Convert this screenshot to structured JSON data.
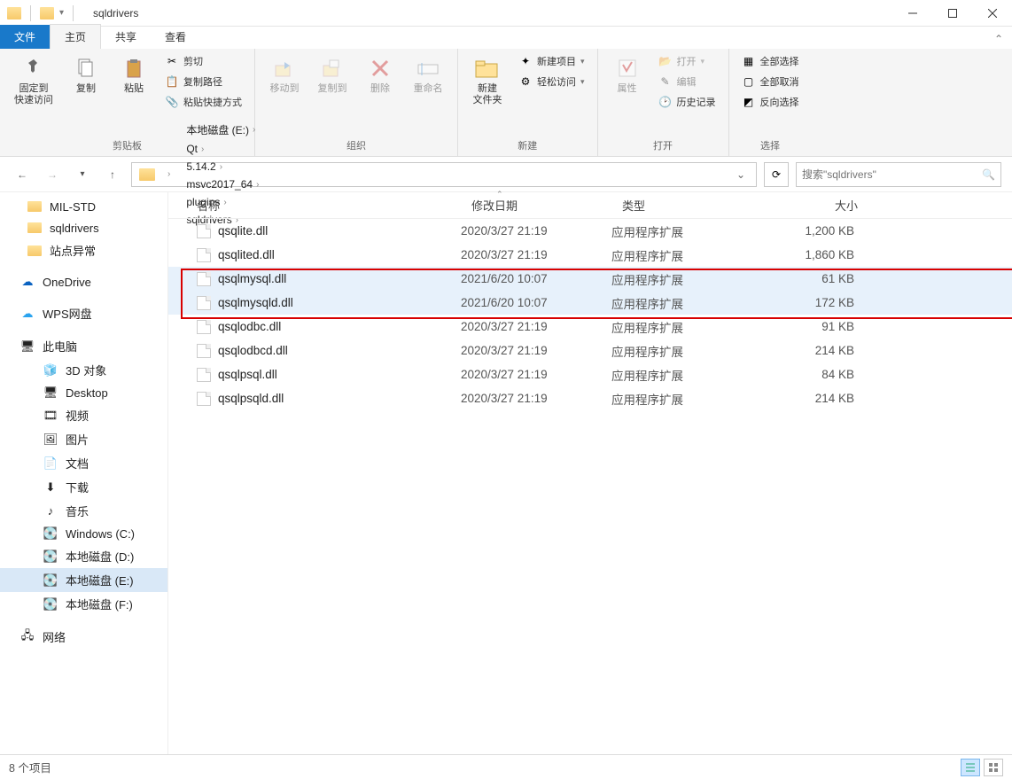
{
  "window": {
    "title": "sqldrivers"
  },
  "tabs": {
    "file": "文件",
    "home": "主页",
    "share": "共享",
    "view": "查看"
  },
  "ribbon": {
    "clipboard": {
      "label": "剪贴板",
      "pin": "固定到\n快速访问",
      "copy": "复制",
      "paste": "粘贴",
      "cut": "剪切",
      "copypath": "复制路径",
      "paste_shortcut": "粘贴快捷方式"
    },
    "organize": {
      "label": "组织",
      "moveto": "移动到",
      "copyto": "复制到",
      "delete": "删除",
      "rename": "重命名"
    },
    "new": {
      "label": "新建",
      "newfolder": "新建\n文件夹",
      "newitem": "新建项目",
      "easyaccess": "轻松访问"
    },
    "open": {
      "label": "打开",
      "properties": "属性",
      "open": "打开",
      "edit": "编辑",
      "history": "历史记录"
    },
    "select": {
      "label": "选择",
      "all": "全部选择",
      "none": "全部取消",
      "invert": "反向选择"
    }
  },
  "breadcrumb": [
    "本地磁盘 (E:)",
    "Qt",
    "5.14.2",
    "msvc2017_64",
    "plugins",
    "sqldrivers"
  ],
  "search": {
    "placeholder": "搜索\"sqldrivers\""
  },
  "columns": {
    "name": "名称",
    "date": "修改日期",
    "type": "类型",
    "size": "大小"
  },
  "sidebar": {
    "folders": [
      "MIL-STD",
      "sqldrivers",
      "站点异常"
    ],
    "onedrive": "OneDrive",
    "wps": "WPS网盘",
    "thispc": "此电脑",
    "pc_items": [
      {
        "label": "3D 对象",
        "icon": "cube"
      },
      {
        "label": "Desktop",
        "icon": "desktop"
      },
      {
        "label": "视频",
        "icon": "video"
      },
      {
        "label": "图片",
        "icon": "pictures"
      },
      {
        "label": "文档",
        "icon": "docs"
      },
      {
        "label": "下载",
        "icon": "downloads"
      },
      {
        "label": "音乐",
        "icon": "music"
      },
      {
        "label": "Windows (C:)",
        "icon": "drive-win"
      },
      {
        "label": "本地磁盘 (D:)",
        "icon": "drive"
      },
      {
        "label": "本地磁盘 (E:)",
        "icon": "drive"
      },
      {
        "label": "本地磁盘 (F:)",
        "icon": "drive"
      }
    ],
    "network": "网络"
  },
  "files": [
    {
      "name": "qsqlite.dll",
      "date": "2020/3/27 21:19",
      "type": "应用程序扩展",
      "size": "1,200 KB"
    },
    {
      "name": "qsqlited.dll",
      "date": "2020/3/27 21:19",
      "type": "应用程序扩展",
      "size": "1,860 KB"
    },
    {
      "name": "qsqlmysql.dll",
      "date": "2021/6/20 10:07",
      "type": "应用程序扩展",
      "size": "61 KB"
    },
    {
      "name": "qsqlmysqld.dll",
      "date": "2021/6/20 10:07",
      "type": "应用程序扩展",
      "size": "172 KB"
    },
    {
      "name": "qsqlodbc.dll",
      "date": "2020/3/27 21:19",
      "type": "应用程序扩展",
      "size": "91 KB"
    },
    {
      "name": "qsqlodbcd.dll",
      "date": "2020/3/27 21:19",
      "type": "应用程序扩展",
      "size": "214 KB"
    },
    {
      "name": "qsqlpsql.dll",
      "date": "2020/3/27 21:19",
      "type": "应用程序扩展",
      "size": "84 KB"
    },
    {
      "name": "qsqlpsqld.dll",
      "date": "2020/3/27 21:19",
      "type": "应用程序扩展",
      "size": "214 KB"
    }
  ],
  "status": {
    "count": "8 个项目"
  },
  "highlight_rows": [
    2,
    3
  ],
  "selected_sidebar": "本地磁盘 (E:)"
}
